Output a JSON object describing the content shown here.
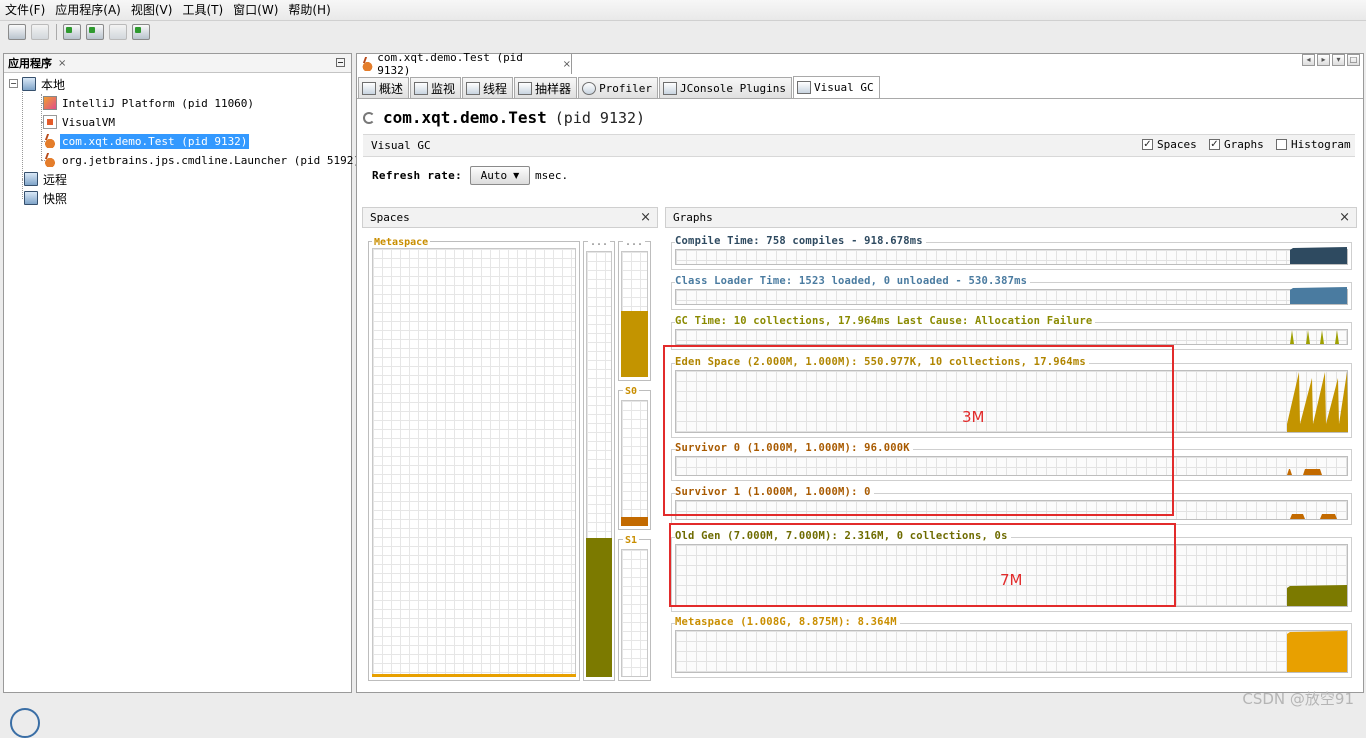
{
  "menu": [
    "文件(F)",
    "应用程序(A)",
    "视图(V)",
    "工具(T)",
    "窗口(W)",
    "帮助(H)"
  ],
  "left_panel": {
    "title": "应用程序",
    "close": "×",
    "local": "本地",
    "apps": [
      "IntelliJ Platform (pid 11060)",
      "VisualVM",
      "com.xqt.demo.Test (pid 9132)",
      "org.jetbrains.jps.cmdline.Launcher (pid 5192)"
    ],
    "remote": "远程",
    "snapshot": "快照"
  },
  "doc_tab": {
    "label": "com.xqt.demo.Test (pid 9132)",
    "close": "×"
  },
  "sub_tabs": [
    "概述",
    "监视",
    "线程",
    "抽样器",
    "Profiler",
    "JConsole Plugins",
    "Visual GC"
  ],
  "app": {
    "name": "com.xqt.demo.Test",
    "pid": "(pid 9132)"
  },
  "visual_gc": {
    "label": "Visual GC",
    "checkboxes": [
      {
        "label": "Spaces",
        "checked": true
      },
      {
        "label": "Graphs",
        "checked": true
      },
      {
        "label": "Histogram",
        "checked": false
      }
    ],
    "refresh_label": "Refresh rate:",
    "refresh_value": "Auto",
    "refresh_unit": "msec."
  },
  "spaces": {
    "title": "Spaces",
    "close": "×",
    "metaspace": "Metaspace",
    "col2_title": "...",
    "col3_title": "...",
    "s0": "S0",
    "s1": "S1"
  },
  "graphs": {
    "title": "Graphs",
    "close": "×",
    "compile": "Compile Time: 758 compiles - 918.678ms",
    "classloader": "Class Loader Time: 1523 loaded, 0 unloaded - 530.387ms",
    "gctime": "GC Time: 10 collections, 17.964ms Last Cause: Allocation Failure",
    "eden": "Eden Space (2.000M, 1.000M): 550.977K, 10 collections, 17.964ms",
    "survivor0": "Survivor 0 (1.000M, 1.000M): 96.000K",
    "survivor1": "Survivor 1 (1.000M, 1.000M): 0",
    "oldgen": "Old Gen (7.000M, 7.000M): 2.316M, 0 collections, 0s",
    "metaspace": "Metaspace (1.008G, 8.875M): 8.364M"
  },
  "annotations": {
    "young": "3M",
    "old": "7M"
  },
  "watermark": "CSDN @放空91",
  "colors": {
    "compile": "#2e4a60",
    "classloader": "#4a7ba0",
    "gc": "#9fa000",
    "eden": "#c39400",
    "survivor": "#c36a00",
    "oldgen": "#7c7a00",
    "metaspace": "#e8a000",
    "annotation": "#e22b2b"
  }
}
